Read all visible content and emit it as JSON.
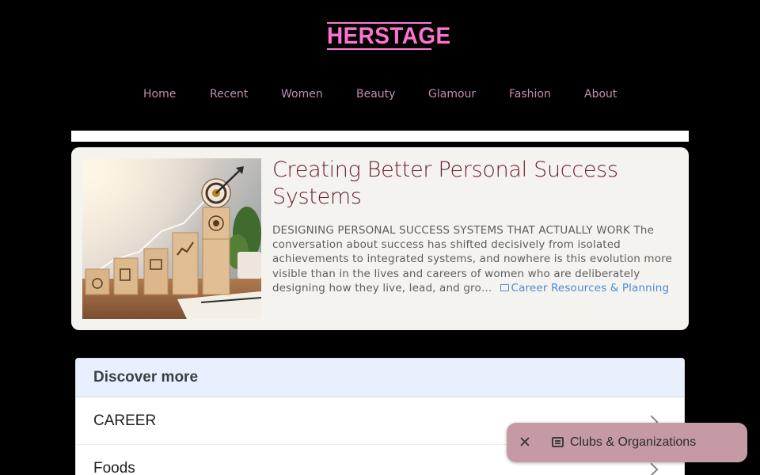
{
  "site": {
    "logo_text": "HERSTAGE"
  },
  "nav": {
    "items": [
      {
        "label": "Home"
      },
      {
        "label": "Recent"
      },
      {
        "label": "Women"
      },
      {
        "label": "Beauty"
      },
      {
        "label": "Glamour"
      },
      {
        "label": "Fashion"
      },
      {
        "label": "About"
      }
    ]
  },
  "featured": {
    "title": "Creating Better Personal Success Systems",
    "excerpt": "DESIGNING PERSONAL SUCCESS SYSTEMS THAT ACTUALLY WORK The conversation about success has shifted decisively from isolated achievements to integrated systems, and nowhere is this evolution more visible than in the lives and careers of women who are deliberately designing how they live, lead, and gro…",
    "category": "Career Resources & Planning",
    "category_icon": "newspaper-icon",
    "image_alt": "wooden blocks staircase with target icon"
  },
  "discover": {
    "heading": "Discover more",
    "items": [
      {
        "label": "CAREER"
      },
      {
        "label": "Foods"
      }
    ]
  },
  "toast": {
    "label": "Clubs & Organizations",
    "icon": "newspaper-icon"
  },
  "colors": {
    "background": "#000000",
    "logo": "#ff73d0",
    "nav_text": "#c08fb1",
    "title": "#6b1f28",
    "link": "#4b8bd0",
    "discover_header": "#e8f0fe",
    "toast_bg": "#c69aa4"
  }
}
